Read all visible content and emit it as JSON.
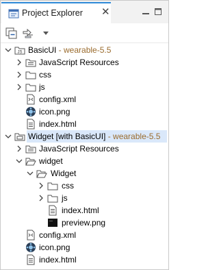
{
  "tab": {
    "title": "Project Explorer",
    "close": "✕"
  },
  "tree": {
    "basicui": {
      "name": "BasicUI",
      "suffix": " - wearable-5.5"
    },
    "b_js_resources": "JavaScript Resources",
    "b_css": "css",
    "b_js": "js",
    "b_config": "config.xml",
    "b_icon": "icon.png",
    "b_index": "index.html",
    "widget": {
      "name": "Widget [with BasicUI]",
      "suffix": " - wearable-5.5"
    },
    "w_js_resources": "JavaScript Resources",
    "w_widget_folder": "widget",
    "w_widget_sub": "Widget",
    "w_css": "css",
    "w_js": "js",
    "w_index_inner": "index.html",
    "w_preview": "preview.png",
    "w_config": "config.xml",
    "w_icon": "icon.png",
    "w_index": "index.html"
  },
  "colors": {
    "accent": "#2e89d8",
    "selection": "#dae8fa",
    "version_text": "#9a6b2d"
  }
}
